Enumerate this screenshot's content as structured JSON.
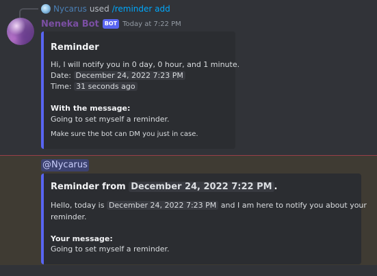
{
  "reply": {
    "username": "Nycarus",
    "used": "used",
    "command": "/reminder add"
  },
  "message1": {
    "author": "Neneka Bot",
    "bot_tag": "BOT",
    "timestamp": "Today at 7:22 PM",
    "embed": {
      "title": "Reminder",
      "line1": "Hi, I will notify you in 0 day, 0 hour, and 1 minute.",
      "date_label": "Date:",
      "date_value": "December 24, 2022 7:23 PM",
      "time_label": "Time:",
      "time_value": "31 seconds ago",
      "field_name": "With the message:",
      "field_value": "Going to set myself a reminder.",
      "footer": "Make sure the bot can DM you just in case."
    }
  },
  "message2": {
    "mention": "@Nycarus",
    "embed": {
      "title_prefix": "Reminder from",
      "title_date": "December 24, 2022 7:22 PM",
      "title_suffix": ".",
      "line1_prefix": "Hello, today is",
      "line1_date": "December 24, 2022 7:23 PM",
      "line1_suffix": "and I am here to notify you about your",
      "line2": "reminder.",
      "field_name": "Your message:",
      "field_value": "Going to set myself a reminder."
    }
  },
  "colors": {
    "background": "#313338",
    "embed_bg": "#2b2d31",
    "embed_accent": "#5865f2",
    "mention_highlight": "#3f3b33",
    "author": "#7b4fa3",
    "command": "#00a8fc"
  }
}
